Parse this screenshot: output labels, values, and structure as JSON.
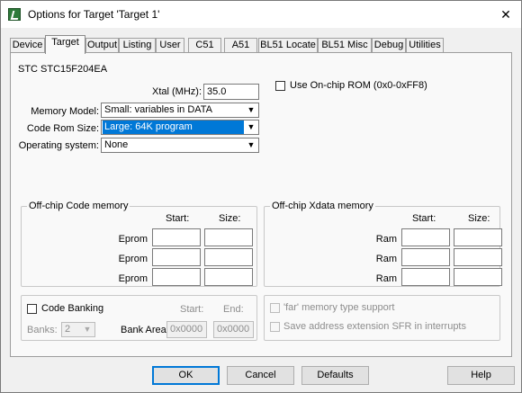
{
  "window": {
    "title": "Options for Target 'Target 1'",
    "close_glyph": "✕"
  },
  "tabs": [
    {
      "label": "Device"
    },
    {
      "label": "Target"
    },
    {
      "label": "Output"
    },
    {
      "label": "Listing"
    },
    {
      "label": "User"
    },
    {
      "label": "C51"
    },
    {
      "label": "A51"
    },
    {
      "label": "BL51 Locate"
    },
    {
      "label": "BL51 Misc"
    },
    {
      "label": "Debug"
    },
    {
      "label": "Utilities"
    }
  ],
  "active_tab": "Target",
  "device_name": "STC STC15F204EA",
  "xtal": {
    "label": "Xtal (MHz):",
    "value": "35.0"
  },
  "onchip_rom": {
    "label": "Use On-chip ROM (0x0-0xFF8)",
    "checked": false
  },
  "memory_model": {
    "label": "Memory Model:",
    "value": "Small: variables in DATA"
  },
  "code_rom_size": {
    "label": "Code Rom Size:",
    "value": "Large: 64K program"
  },
  "operating_system": {
    "label": "Operating system:",
    "value": "None"
  },
  "offchip_code": {
    "title": "Off-chip Code memory",
    "start_header": "Start:",
    "size_header": "Size:",
    "rows": [
      {
        "label": "Eprom",
        "start": "",
        "size": ""
      },
      {
        "label": "Eprom",
        "start": "",
        "size": ""
      },
      {
        "label": "Eprom",
        "start": "",
        "size": ""
      }
    ]
  },
  "offchip_xdata": {
    "title": "Off-chip Xdata memory",
    "start_header": "Start:",
    "size_header": "Size:",
    "rows": [
      {
        "label": "Ram",
        "start": "",
        "size": ""
      },
      {
        "label": "Ram",
        "start": "",
        "size": ""
      },
      {
        "label": "Ram",
        "start": "",
        "size": ""
      }
    ]
  },
  "code_banking": {
    "label": "Code Banking",
    "start_header": "Start:",
    "end_header": "End:",
    "banks_label": "Banks:",
    "banks_value": "2",
    "bank_area_label": "Bank Area:",
    "bank_area_start": "0x0000",
    "bank_area_end": "0x0000"
  },
  "far_memory": {
    "label": "'far' memory type support"
  },
  "save_addr_ext": {
    "label": "Save address extension SFR in interrupts"
  },
  "buttons": {
    "ok": "OK",
    "cancel": "Cancel",
    "defaults": "Defaults",
    "help": "Help"
  },
  "icons": {
    "app": "keil-uvision-icon",
    "dropdown": "chevron-down-icon",
    "close": "close-icon"
  },
  "colors": {
    "selection": "#0078d7",
    "window_bg": "#f0f0f0",
    "panel_bg": "#f9f9f9"
  }
}
